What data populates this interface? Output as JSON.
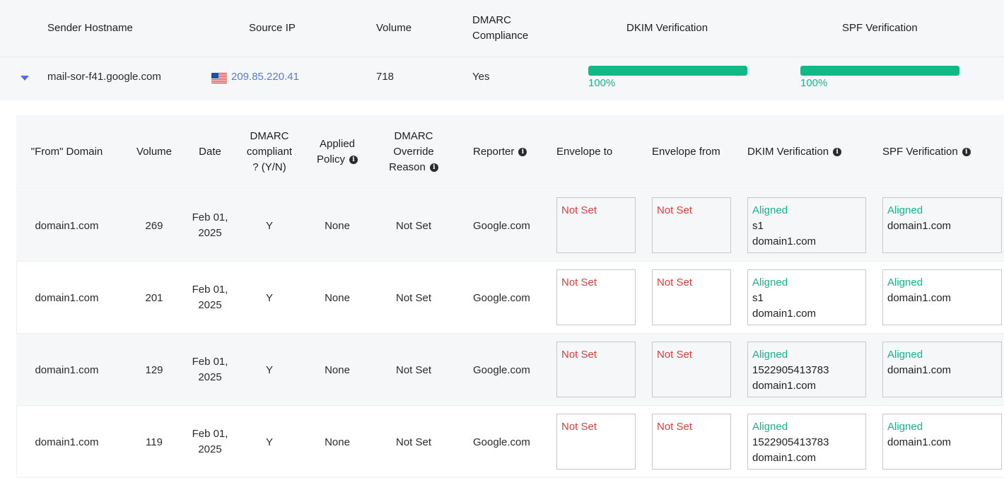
{
  "outer": {
    "headers": {
      "sender_hostname": "Sender Hostname",
      "source_ip": "Source IP",
      "volume": "Volume",
      "dmarc_line1": "DMARC",
      "dmarc_line2": "Compliance",
      "dkim": "DKIM Verification",
      "spf": "SPF Verification"
    },
    "row": {
      "hostname": "mail-sor-f41.google.com",
      "flag_icon": "us-flag-icon",
      "ip": "209.85.220.41",
      "volume": "718",
      "compliance": "Yes",
      "dkim_percent": 100,
      "dkim_label": "100%",
      "spf_percent": 100,
      "spf_label": "100%"
    }
  },
  "inner": {
    "headers": {
      "from_domain": "\"From\" Domain",
      "volume": "Volume",
      "date": "Date",
      "compliant_l1": "DMARC",
      "compliant_l2": "compliant",
      "compliant_l3": "? (Y/N)",
      "policy_l1": "Applied",
      "policy_l2": "Policy",
      "override_l1": "DMARC",
      "override_l2": "Override",
      "override_l3": "Reason",
      "reporter": "Reporter",
      "envelope_to": "Envelope to",
      "envelope_from": "Envelope from",
      "dkim": "DKIM Verification",
      "spf": "SPF Verification"
    },
    "rows": [
      {
        "domain": "domain1.com",
        "volume": "269",
        "date_l1": "Feb 01,",
        "date_l2": "2025",
        "compliant": "Y",
        "policy": "None",
        "override": "Not Set",
        "reporter": "Google.com",
        "env_to": "Not Set",
        "env_from": "Not Set",
        "dkim_status": "Aligned",
        "dkim_selector": "s1",
        "dkim_domain": "domain1.com",
        "spf_status": "Aligned",
        "spf_domain": "domain1.com"
      },
      {
        "domain": "domain1.com",
        "volume": "201",
        "date_l1": "Feb 01,",
        "date_l2": "2025",
        "compliant": "Y",
        "policy": "None",
        "override": "Not Set",
        "reporter": "Google.com",
        "env_to": "Not Set",
        "env_from": "Not Set",
        "dkim_status": "Aligned",
        "dkim_selector": "s1",
        "dkim_domain": "domain1.com",
        "spf_status": "Aligned",
        "spf_domain": "domain1.com"
      },
      {
        "domain": "domain1.com",
        "volume": "129",
        "date_l1": "Feb 01,",
        "date_l2": "2025",
        "compliant": "Y",
        "policy": "None",
        "override": "Not Set",
        "reporter": "Google.com",
        "env_to": "Not Set",
        "env_from": "Not Set",
        "dkim_status": "Aligned",
        "dkim_selector": "1522905413783",
        "dkim_domain": "domain1.com",
        "spf_status": "Aligned",
        "spf_domain": "domain1.com"
      },
      {
        "domain": "domain1.com",
        "volume": "119",
        "date_l1": "Feb 01,",
        "date_l2": "2025",
        "compliant": "Y",
        "policy": "None",
        "override": "Not Set",
        "reporter": "Google.com",
        "env_to": "Not Set",
        "env_from": "Not Set",
        "dkim_status": "Aligned",
        "dkim_selector": "1522905413783",
        "dkim_domain": "domain1.com",
        "spf_status": "Aligned",
        "spf_domain": "domain1.com"
      }
    ]
  },
  "colors": {
    "aligned": "#12b886",
    "not_set": "#e03c3c",
    "link": "#5b7ad6",
    "bar": "#12b886",
    "header_bg": "#f6f7f9"
  },
  "icons": {
    "expand": "caret-down-icon",
    "info": "info-icon"
  }
}
